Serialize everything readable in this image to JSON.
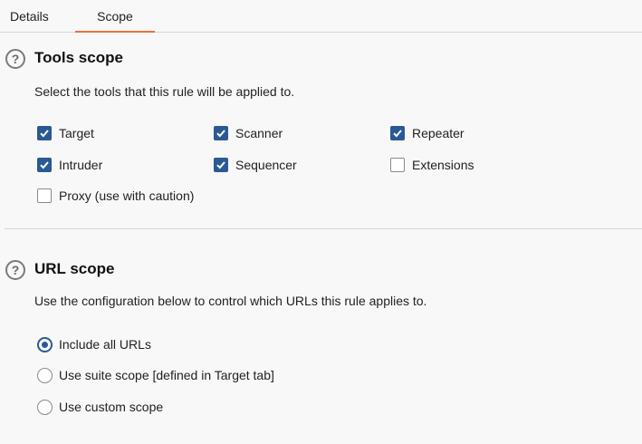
{
  "tabs": [
    {
      "label": "Details"
    },
    {
      "label": "Scope",
      "active": true
    }
  ],
  "tools_scope": {
    "title": "Tools scope",
    "description": "Select the tools that this rule will be applied to.",
    "tools": [
      {
        "label": "Target",
        "checked": true
      },
      {
        "label": "Scanner",
        "checked": true
      },
      {
        "label": "Repeater",
        "checked": true
      },
      {
        "label": "Intruder",
        "checked": true
      },
      {
        "label": "Sequencer",
        "checked": true
      },
      {
        "label": "Extensions",
        "checked": false
      },
      {
        "label": "Proxy (use with caution)",
        "checked": false
      }
    ]
  },
  "url_scope": {
    "title": "URL scope",
    "description": "Use the configuration below to control which URLs this rule applies to.",
    "options": [
      {
        "label": "Include all URLs",
        "selected": true
      },
      {
        "label": "Use suite scope [defined in Target tab]",
        "selected": false
      },
      {
        "label": "Use custom scope",
        "selected": false
      }
    ]
  },
  "help_glyph": "?",
  "colors": {
    "accent": "#e8703a",
    "checkbox": "#2a5a94",
    "background": "#f8f8f8"
  }
}
